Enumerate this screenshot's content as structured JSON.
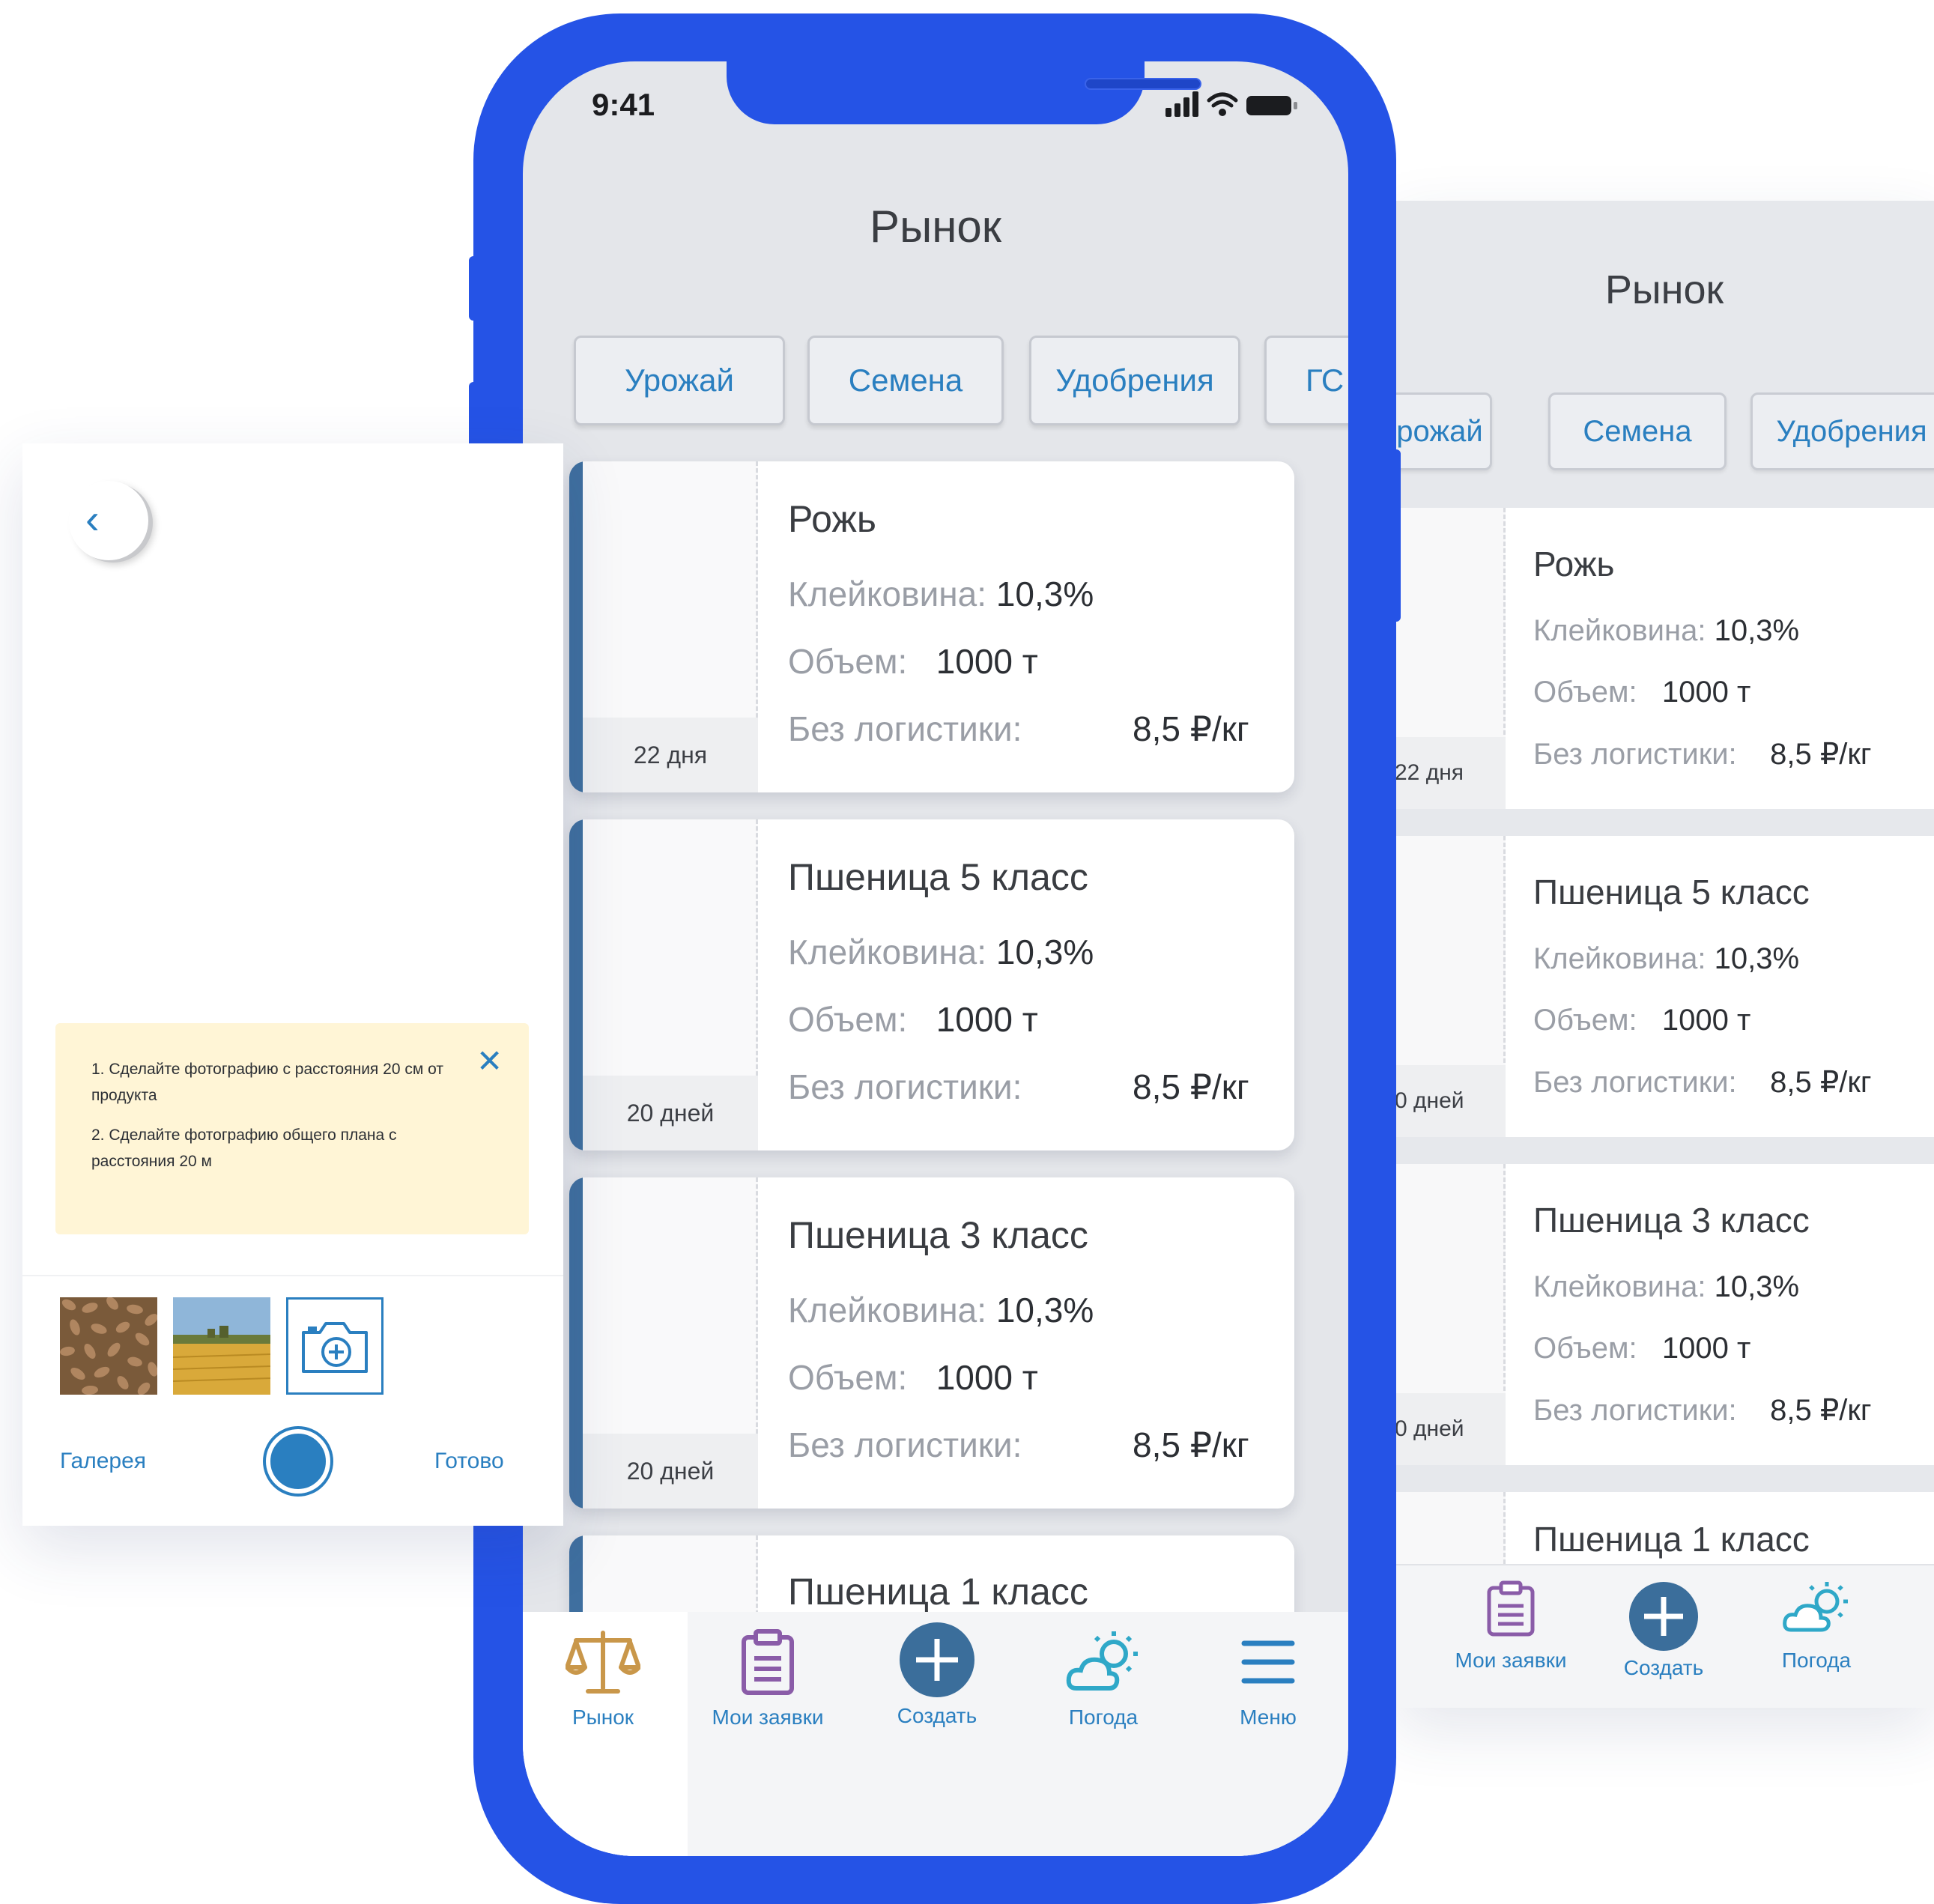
{
  "phone": {
    "status_time": "9:41",
    "title": "Рынок",
    "tabs": [
      "Урожай",
      "Семена",
      "Удобрения",
      "ГС"
    ],
    "cards": [
      {
        "name": "Рожь",
        "days": "22 дня",
        "gluten_label": "Клейковина:",
        "gluten": "10,3%",
        "volume_label": "Объем:",
        "volume": "1000 т",
        "logistics_label": "Без логистики:",
        "price": "8,5 ₽/кг"
      },
      {
        "name": "Пшеница 5 класс",
        "days": "20 дней",
        "gluten_label": "Клейковина:",
        "gluten": "10,3%",
        "volume_label": "Объем:",
        "volume": "1000 т",
        "logistics_label": "Без логистики:",
        "price": "8,5 ₽/кг"
      },
      {
        "name": "Пшеница 3 класс",
        "days": "20 дней",
        "gluten_label": "Клейковина:",
        "gluten": "10,3%",
        "volume_label": "Объем:",
        "volume": "1000 т",
        "logistics_label": "Без логистики:",
        "price": "8,5 ₽/кг"
      },
      {
        "name": "Пшеница 1 класс"
      }
    ],
    "nav": [
      {
        "label": "Рынок",
        "icon": "scales-icon",
        "active": true
      },
      {
        "label": "Мои заявки",
        "icon": "clipboard-icon"
      },
      {
        "label": "Создать",
        "icon": "plus-circle-icon"
      },
      {
        "label": "Погода",
        "icon": "weather-icon"
      },
      {
        "label": "Меню",
        "icon": "menu-icon"
      }
    ]
  },
  "background_screen": {
    "title": "Рынок",
    "tabs": [
      "рожай",
      "Семена",
      "Удобрения"
    ],
    "cards": [
      {
        "name": "Рожь",
        "days": "22 дня",
        "gluten_label": "Клейковина:",
        "gluten": "10,3%",
        "volume_label": "Объем:",
        "volume": "1000 т",
        "logistics_label": "Без логистики:",
        "price": "8,5 ₽/кг"
      },
      {
        "name": "Пшеница 5 класс",
        "days": "0 дней",
        "gluten_label": "Клейковина:",
        "gluten": "10,3%",
        "volume_label": "Объем:",
        "volume": "1000 т",
        "logistics_label": "Без логистики:",
        "price": "8,5 ₽/кг"
      },
      {
        "name": "Пшеница 3 класс",
        "days": "0 дней",
        "gluten_label": "Клейковина:",
        "gluten": "10,3%",
        "volume_label": "Объем:",
        "volume": "1000 т",
        "logistics_label": "Без логистики:",
        "price": "8,5 ₽/кг"
      },
      {
        "name": "Пшеница 1 класс"
      }
    ],
    "nav": [
      {
        "label": "Мои заявки",
        "icon": "clipboard-icon"
      },
      {
        "label": "Создать",
        "icon": "plus-circle-icon"
      },
      {
        "label": "Погода",
        "icon": "weather-icon"
      }
    ]
  },
  "camera_panel": {
    "hint_1": "1. Сделайте фотографию с расстояния 20 см от продукта",
    "hint_2": "2. Сделайте фотографию общего плана с расстояния 20 м",
    "gallery_label": "Галерея",
    "done_label": "Готово"
  },
  "colors": {
    "phone_frame": "#2553e6",
    "accent_blue": "#2a7fc0",
    "card_accent": "#3f6f9f",
    "create_button": "#3b6e9b",
    "scales_icon": "#c9974a",
    "clipboard_icon": "#8a5ca8",
    "weather_icon": "#2fa8c8",
    "hint_background": "#fff5d6"
  }
}
